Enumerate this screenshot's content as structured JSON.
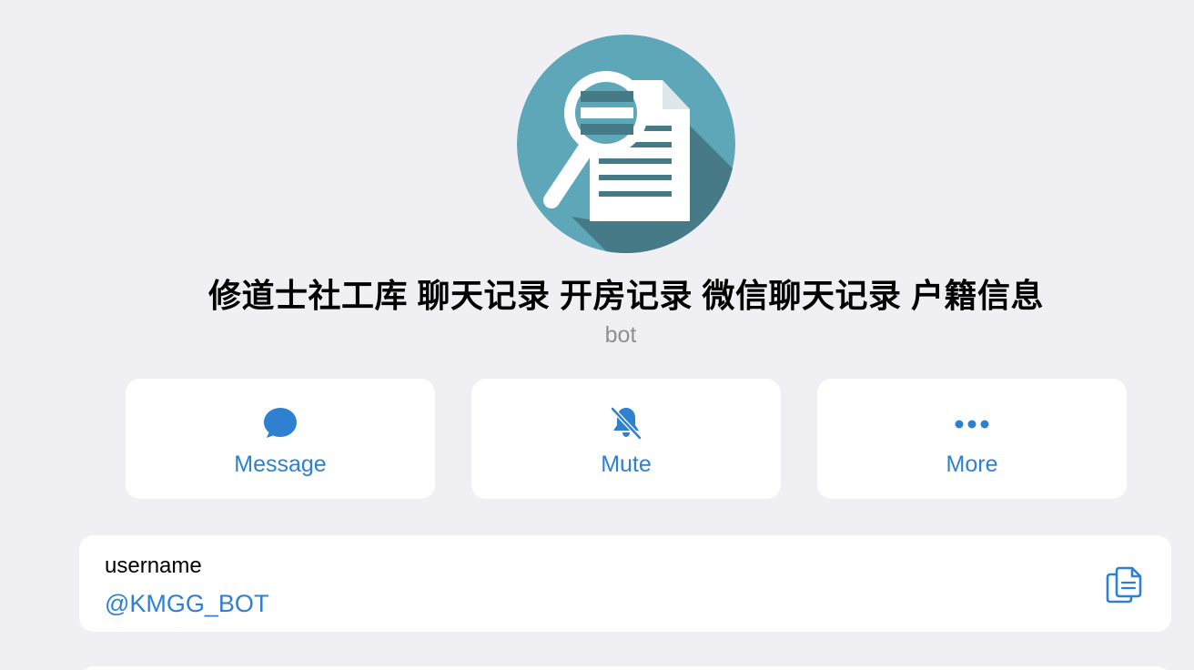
{
  "profile": {
    "avatar_icon": "document-magnifier-icon",
    "name": "修道士社工库 聊天记录 开房记录 微信聊天记录 户籍信息",
    "subtitle": "bot"
  },
  "actions": [
    {
      "label": "Message",
      "icon": "chat-bubble-icon"
    },
    {
      "label": "Mute",
      "icon": "bell-slash-icon"
    },
    {
      "label": "More",
      "icon": "ellipsis-icon"
    }
  ],
  "info": {
    "key": "username",
    "value": "@KMGG_BOT",
    "copy_icon": "copy-icon"
  },
  "colors": {
    "background": "#efeff4",
    "card": "#ffffff",
    "accent": "#2f80d1",
    "avatar_bg": "#5ea7b9",
    "avatar_shadow": "#467a87",
    "secondary_text": "#8e8e93"
  }
}
